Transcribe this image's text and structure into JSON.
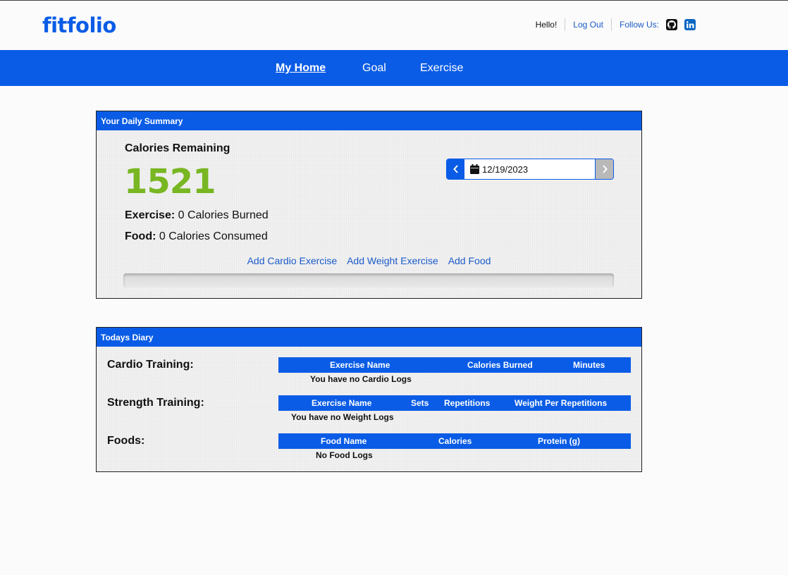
{
  "header": {
    "logo": "fitfolio",
    "greeting": "Hello!",
    "logout": "Log Out",
    "follow": "Follow Us:",
    "social_icons": [
      "github-icon",
      "linkedin-icon"
    ]
  },
  "nav": {
    "items": [
      {
        "label": "My Home",
        "active": true
      },
      {
        "label": "Goal",
        "active": false
      },
      {
        "label": "Exercise",
        "active": false
      }
    ]
  },
  "summary": {
    "title": "Your Daily Summary",
    "calories_label": "Calories Remaining",
    "calories_value": "1521",
    "exercise_label": "Exercise:",
    "exercise_value": "0 Calories Burned",
    "food_label": "Food:",
    "food_value": "0 Calories Consumed",
    "date": "12/19/2023",
    "actions": [
      "Add Cardio Exercise",
      "Add Weight Exercise",
      "Add Food"
    ],
    "progress_fraction": 0
  },
  "diary": {
    "title": "Todays Diary",
    "cardio": {
      "title": "Cardio Training:",
      "columns": [
        "Exercise Name",
        "Calories Burned",
        "Minutes"
      ],
      "empty": "You have no Cardio Logs"
    },
    "strength": {
      "title": "Strength Training:",
      "columns": [
        "Exercise Name",
        "Sets",
        "Repetitions",
        "Weight Per Repetitions"
      ],
      "empty": "You have no Weight Logs"
    },
    "foods": {
      "title": "Foods:",
      "columns": [
        "Food Name",
        "Calories",
        "Protein (g)"
      ],
      "empty": "No Food Logs"
    }
  },
  "colors": {
    "brand_blue": "#0a5ce6",
    "calories_green": "#78b622",
    "link_blue": "#1a5ac8"
  }
}
